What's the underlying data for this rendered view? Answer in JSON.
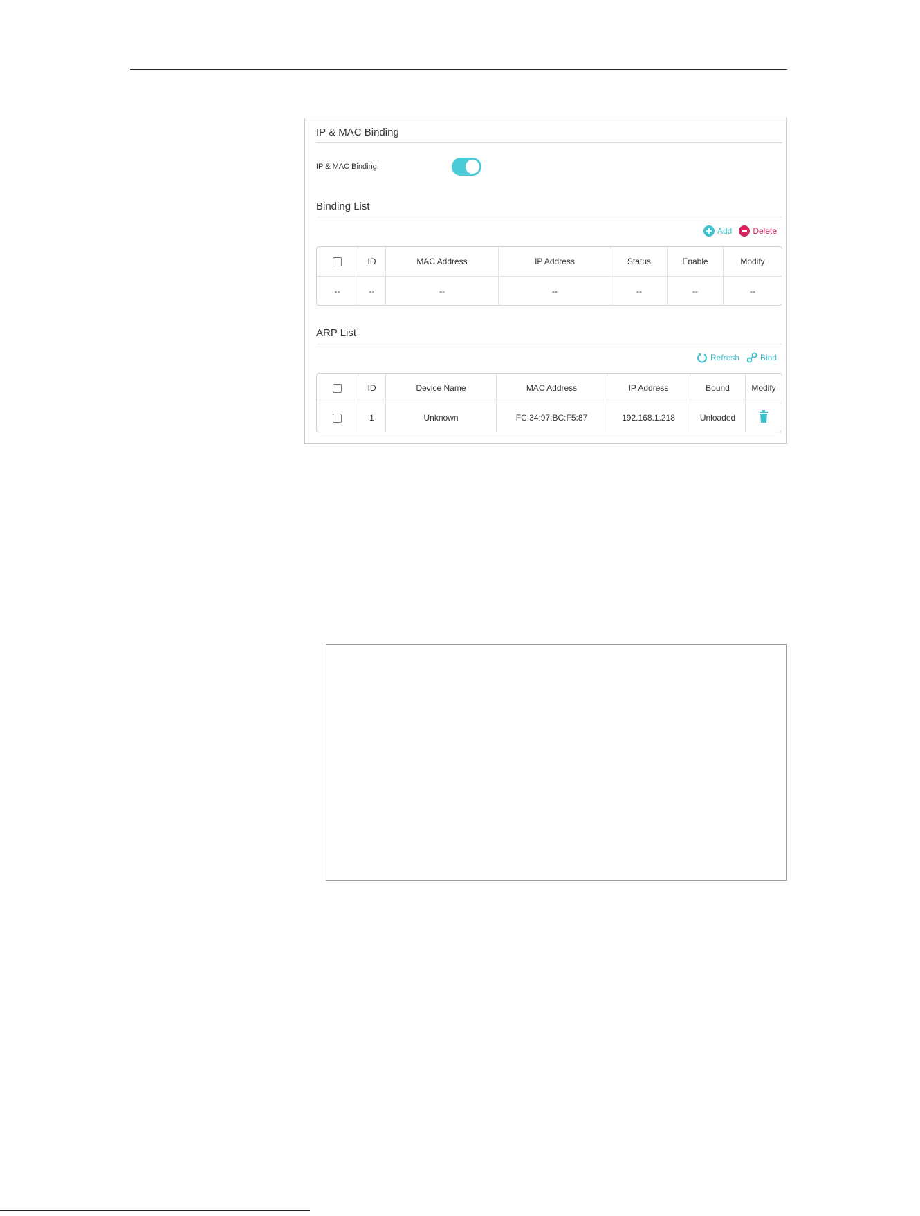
{
  "ip_mac_binding": {
    "title": "IP & MAC Binding",
    "field_label": "IP & MAC Binding:",
    "enabled": true,
    "accent_color": "#4acbd6"
  },
  "binding_list": {
    "title": "Binding List",
    "add_label": "Add",
    "delete_label": "Delete",
    "columns": [
      "",
      "ID",
      "MAC Address",
      "IP Address",
      "Status",
      "Enable",
      "Modify"
    ],
    "rows": [
      [
        "--",
        "--",
        "--",
        "--",
        "--",
        "--",
        "--"
      ]
    ]
  },
  "arp_list": {
    "title": "ARP List",
    "refresh_label": "Refresh",
    "bind_label": "Bind",
    "columns": [
      "",
      "ID",
      "Device Name",
      "MAC Address",
      "IP Address",
      "Bound",
      "Modify"
    ],
    "rows": [
      {
        "id": "1",
        "device_name": "Unknown",
        "mac": "FC:34:97:BC:F5:87",
        "ip": "192.168.1.218",
        "bound": "Unloaded",
        "modify_icon": "trash-icon"
      }
    ]
  },
  "colors": {
    "teal": "#3fbfcb",
    "pink": "#d4245b"
  }
}
